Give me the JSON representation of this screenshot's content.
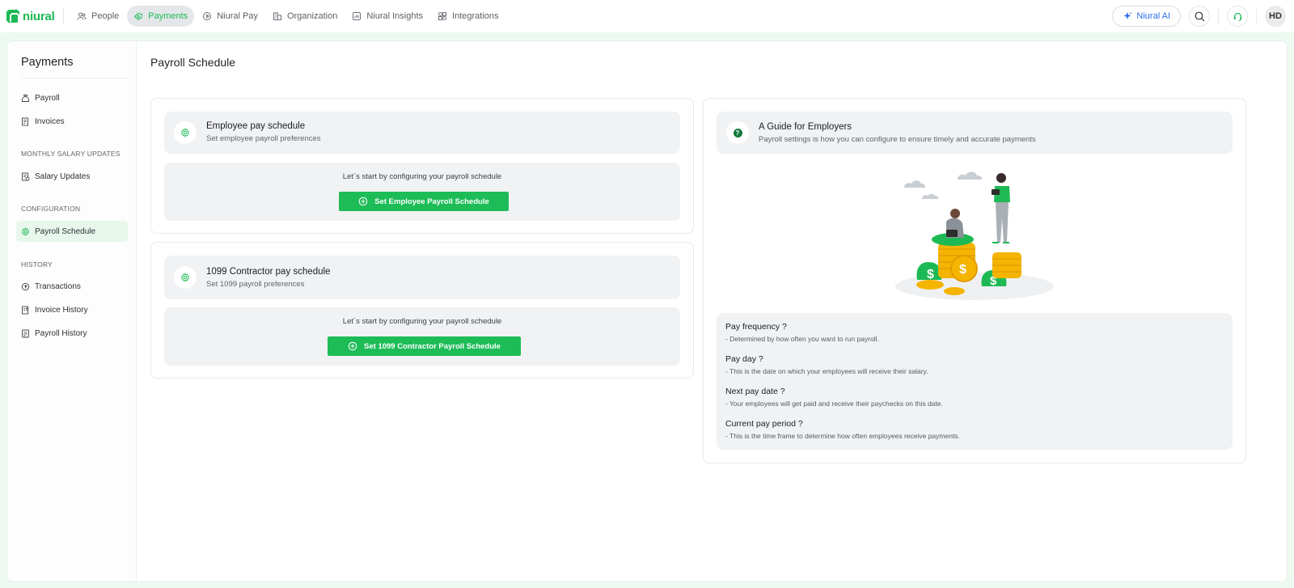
{
  "brand": {
    "name": "niural",
    "color": "#1db954"
  },
  "nav": {
    "items": [
      {
        "label": "People",
        "icon": "people-icon",
        "active": false
      },
      {
        "label": "Payments",
        "icon": "payments-icon",
        "active": true
      },
      {
        "label": "Niural Pay",
        "icon": "niural-pay-icon",
        "active": false
      },
      {
        "label": "Organization",
        "icon": "organization-icon",
        "active": false
      },
      {
        "label": "Niural Insights",
        "icon": "insights-icon",
        "active": false
      },
      {
        "label": "Integrations",
        "icon": "integrations-icon",
        "active": false
      }
    ],
    "ai_label": "Niural AI",
    "avatar_initials": "HD"
  },
  "sidebar": {
    "title": "Payments",
    "items": [
      {
        "label": "Payroll",
        "icon": "money-bag-icon"
      },
      {
        "label": "Invoices",
        "icon": "invoice-icon"
      }
    ],
    "sections": [
      {
        "title": "MONTHLY SALARY UPDATES",
        "items": [
          {
            "label": "Salary Updates",
            "icon": "salary-updates-icon"
          }
        ]
      },
      {
        "title": "CONFIGURATION",
        "items": [
          {
            "label": "Payroll Schedule",
            "icon": "gear-icon",
            "active": true
          }
        ]
      },
      {
        "title": "HISTORY",
        "items": [
          {
            "label": "Transactions",
            "icon": "transactions-icon"
          },
          {
            "label": "Invoice History",
            "icon": "invoice-history-icon"
          },
          {
            "label": "Payroll History",
            "icon": "payroll-history-icon"
          }
        ]
      }
    ]
  },
  "main": {
    "title": "Payroll Schedule",
    "employee": {
      "title": "Employee pay schedule",
      "subtitle": "Set employee payroll preferences",
      "message": "Let´s start by configuring your payroll schedule",
      "button": "Set Employee Payroll Schedule"
    },
    "contractor": {
      "title": "1099 Contractor pay schedule",
      "subtitle": "Set 1099 payroll preferences",
      "message": "Let´s start by configuring your payroll schedule",
      "button": "Set 1099 Contractor Payroll Schedule"
    },
    "guide": {
      "title": "A Guide for Employers",
      "subtitle": "Payroll settings is how you can configure to ensure timely and accurate payments",
      "faqs": [
        {
          "q": "Pay frequency ?",
          "a": "- Determined by how often you want to run payroll."
        },
        {
          "q": "Pay day ?",
          "a": "- This is the date on which your employees will receive their salary."
        },
        {
          "q": "Next pay date ?",
          "a": "- Your employees will get paid and receive their paychecks on this date."
        },
        {
          "q": "Current pay period ?",
          "a": "- This is the time frame to determine how often employees receive payments."
        }
      ]
    }
  },
  "colors": {
    "accent": "#1dbc57",
    "active_nav_bg": "#e4e7ea",
    "ai_text": "#2b6de8"
  }
}
